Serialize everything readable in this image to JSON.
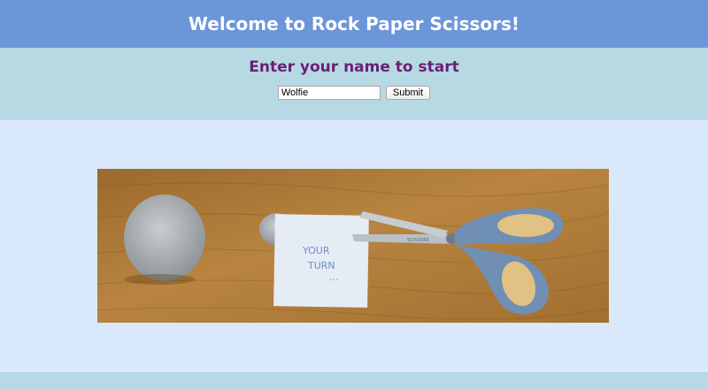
{
  "header": {
    "title": "Welcome to Rock Paper Scissors!"
  },
  "name_form": {
    "prompt": "Enter your name to start",
    "name_value": "Wolfie",
    "submit_label": "Submit"
  },
  "hero_image": {
    "note_text_line1": "YOUR",
    "note_text_line2": "TURN",
    "note_text_line3": "...",
    "scissors_brand": "SCISSORS"
  },
  "colors": {
    "banner": "#6b96d8",
    "panel": "#b7d9e3",
    "page": "#dae8fc",
    "prompt": "#6b1f74"
  }
}
